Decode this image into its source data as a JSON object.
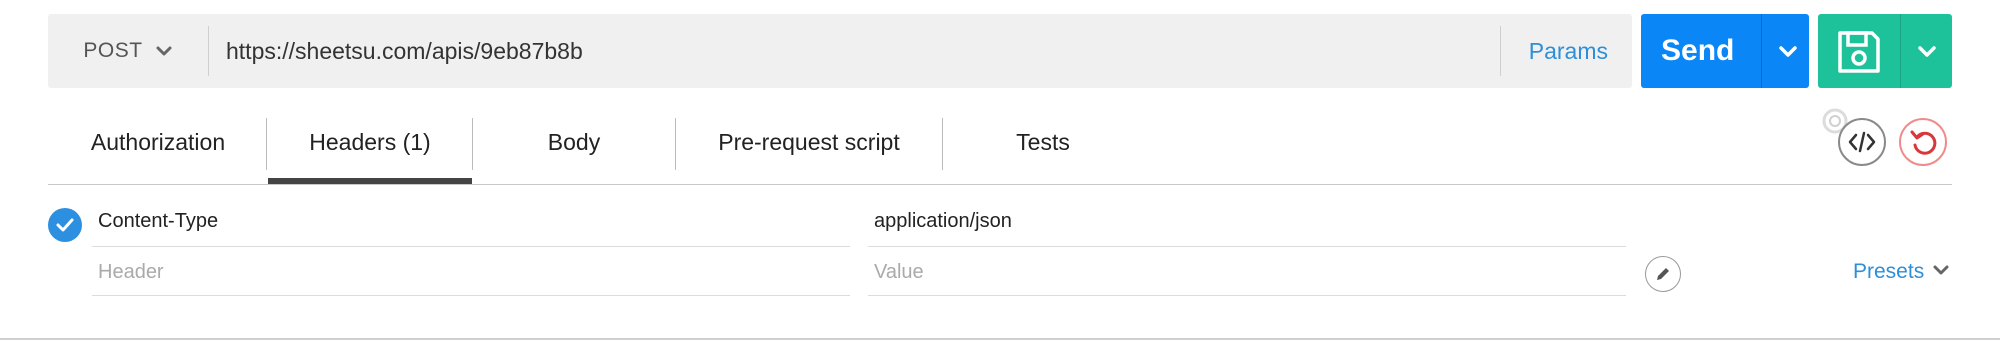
{
  "request": {
    "method": "POST",
    "url": "https://sheetsu.com/apis/9eb87b8b",
    "params_label": "Params"
  },
  "actions": {
    "send_label": "Send"
  },
  "tabs": [
    {
      "label": "Authorization"
    },
    {
      "label": "Headers (1)",
      "active": true
    },
    {
      "label": "Body"
    },
    {
      "label": "Pre-request script"
    },
    {
      "label": "Tests"
    }
  ],
  "headers_table": {
    "rows": [
      {
        "enabled": true,
        "key": "Content-Type",
        "value": "application/json"
      }
    ],
    "new_row": {
      "key_placeholder": "Header",
      "value_placeholder": "Value"
    },
    "presets_label": "Presets"
  },
  "colors": {
    "send": "#0a86f7",
    "save": "#1ec29a",
    "link": "#2d8fd8",
    "reset": "#d9383a"
  },
  "icons": [
    "chevron-down-icon",
    "save-disk-icon",
    "code-icon",
    "reset-icon",
    "check-icon",
    "pencil-icon"
  ]
}
